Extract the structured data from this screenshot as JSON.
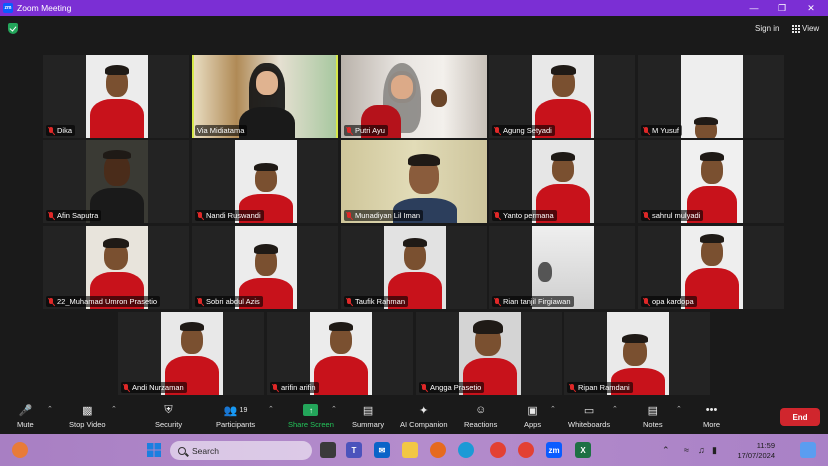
{
  "window": {
    "title": "Zoom Meeting",
    "logo_text": "zm"
  },
  "topbar": {
    "sign_in": "Sign in",
    "view": "View"
  },
  "participants": [
    {
      "name": "Dika",
      "active": false
    },
    {
      "name": "Via Midiatama",
      "active": true
    },
    {
      "name": "Putri Ayu",
      "active": false
    },
    {
      "name": "Agung Setyadi",
      "active": false
    },
    {
      "name": "M Yusuf",
      "active": false
    },
    {
      "name": "Afin Saputra",
      "active": false
    },
    {
      "name": "Nandi Ruswandi",
      "active": false
    },
    {
      "name": "Munadiyan Lil Iman",
      "active": false
    },
    {
      "name": "Yanto permana",
      "active": false
    },
    {
      "name": "sahrul mulyadi",
      "active": false
    },
    {
      "name": "22_Muhamad Umron Prasetio",
      "active": false
    },
    {
      "name": "Sobri abdul Azis",
      "active": false
    },
    {
      "name": "Taufik Rahman",
      "active": false
    },
    {
      "name": "Rian tanjil Firgiawan",
      "active": false
    },
    {
      "name": "opa kardopa",
      "active": false
    },
    {
      "name": "Andi Nurzaman",
      "active": false
    },
    {
      "name": "arifin arifin",
      "active": false
    },
    {
      "name": "Angga Prasetio",
      "active": false
    },
    {
      "name": "Ripan Ramdani",
      "active": false
    }
  ],
  "toolbar": {
    "mute": "Mute",
    "stop_video": "Stop Video",
    "security": "Security",
    "participants": "Participants",
    "participants_count": "19",
    "share_screen": "Share Screen",
    "summary": "Summary",
    "ai_companion": "AI Companion",
    "reactions": "Reactions",
    "apps": "Apps",
    "whiteboards": "Whiteboards",
    "notes": "Notes",
    "more": "More",
    "end": "End"
  },
  "taskbar": {
    "search_placeholder": "Search",
    "time": "11:59",
    "date": "17/07/2024"
  },
  "colors": {
    "titlebar": "#7b2fd4",
    "active_speaker": "#d6e84a",
    "share_green": "#23a55a",
    "end_red": "#d0262d",
    "muted_red": "#e02828"
  }
}
